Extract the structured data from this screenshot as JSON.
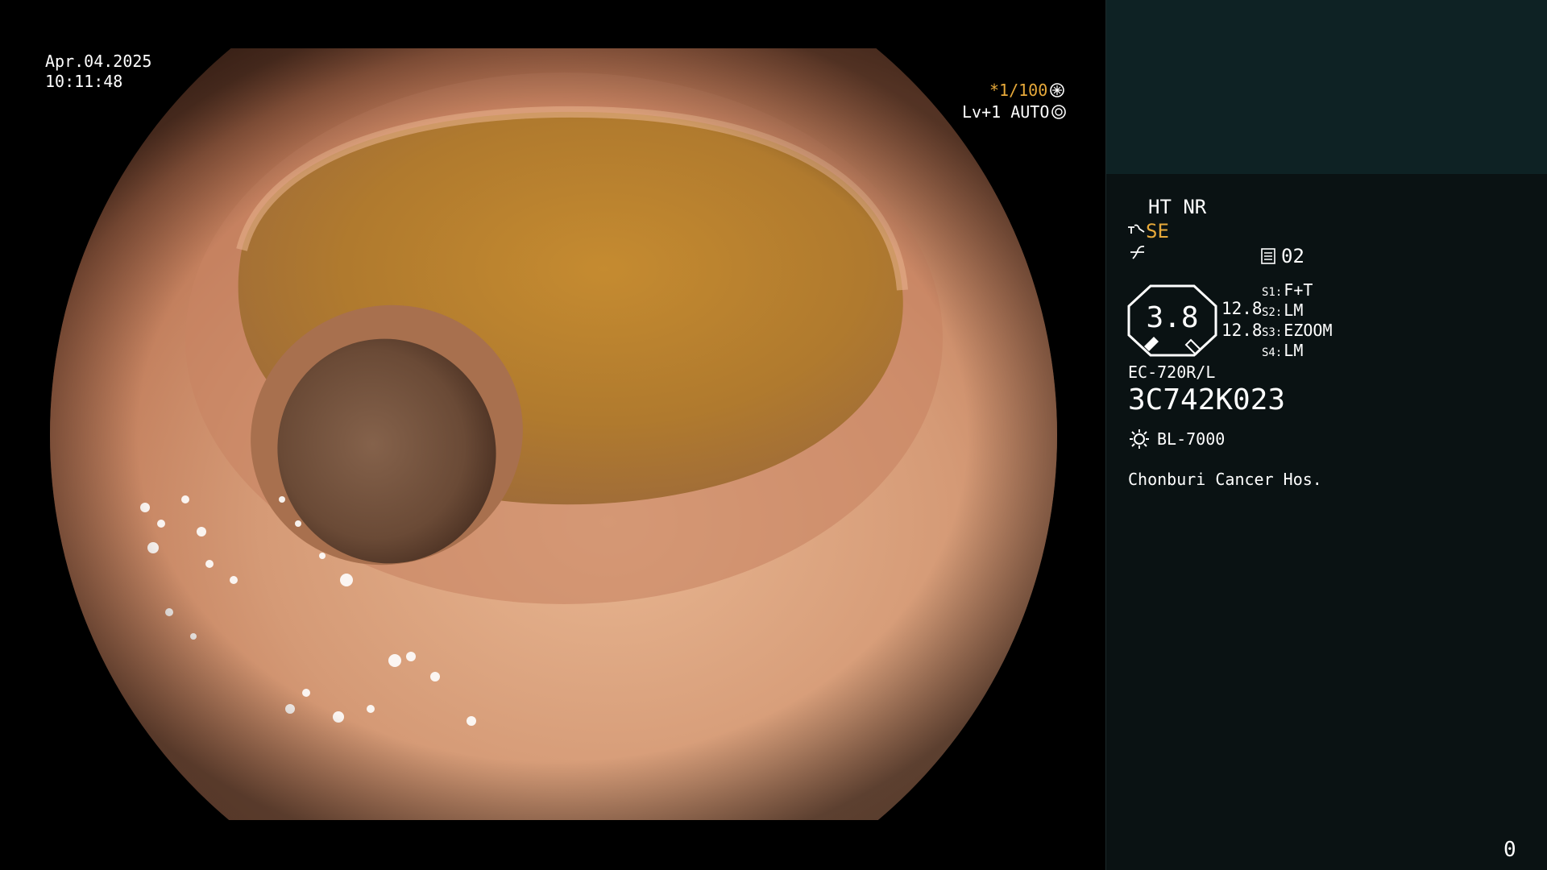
{
  "overlay": {
    "date": "Apr.04.2025",
    "time": "10:11:48",
    "shutter": "*1/100",
    "level": "Lv+1 AUTO"
  },
  "panel": {
    "mode": "HT NR",
    "enhancement": "SE",
    "doc_number": "02",
    "zoom": "3.8",
    "gain_top": "12.8",
    "gain_bottom": "12.8",
    "switches": [
      {
        "key": "S1:",
        "value": "F+T"
      },
      {
        "key": "S2:",
        "value": "LM"
      },
      {
        "key": "S3:",
        "value": "EZOOM"
      },
      {
        "key": "S4:",
        "value": "LM"
      }
    ],
    "scope_model": "EC-720R/L",
    "scope_serial": "3C742K023",
    "light_source": "BL-7000",
    "hospital": "Chonburi Cancer Hos.",
    "counter": "0"
  },
  "colors": {
    "panel_top": "#0e2224",
    "panel_body": "#0a1213",
    "accent_orange": "#e7a93a",
    "mucosa": "#c98a66",
    "fluid": "#b47a2a",
    "lumen": "#6e4a33"
  },
  "icons": [
    "shutter-icon",
    "auto-iris-icon",
    "se-mode-icon",
    "f-mode-icon",
    "document-icon",
    "zoom-octagon-icon",
    "lightbulb-icon"
  ]
}
